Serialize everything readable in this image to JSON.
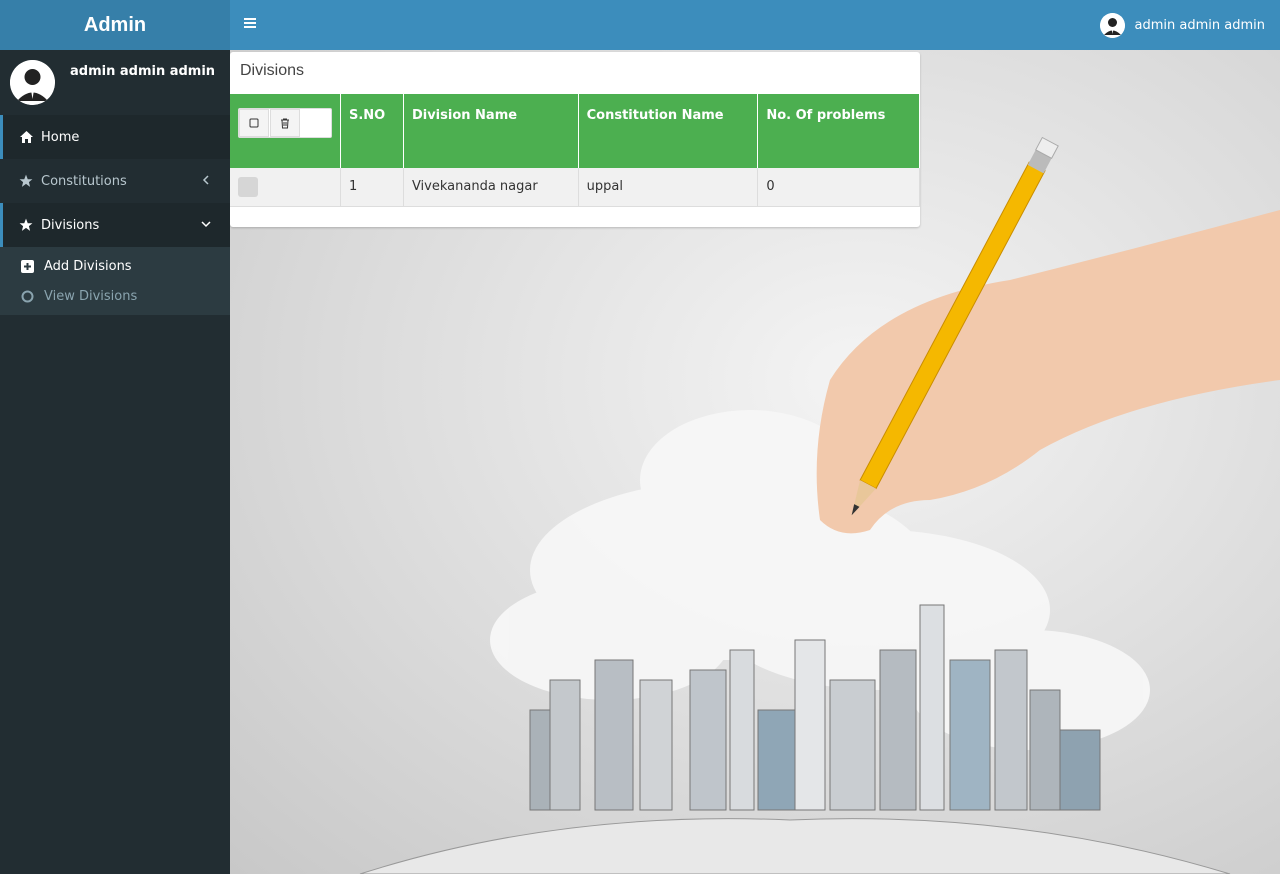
{
  "header": {
    "logo": "Admin",
    "user_name": "admin admin admin"
  },
  "sidebar": {
    "user_name": "admin admin admin",
    "items": [
      {
        "label": "Home",
        "icon": "home-icon"
      },
      {
        "label": "Constitutions",
        "icon": "star-icon"
      },
      {
        "label": "Divisions",
        "icon": "star-icon"
      }
    ],
    "submenu": [
      {
        "label": "Add Divisions",
        "icon": "plus-square-icon"
      },
      {
        "label": "View Divisions",
        "icon": "circle-icon"
      }
    ]
  },
  "page": {
    "title": "Divisions",
    "columns": [
      "S.NO",
      "Division Name",
      "Constitution Name",
      "No. Of problems"
    ],
    "rows": [
      [
        "1",
        "Vivekananda nagar",
        "uppal",
        "0"
      ]
    ]
  },
  "colors": {
    "header": "#3c8dbc",
    "logo_bg": "#367fa9",
    "sidebar": "#222d32",
    "table_header": "#4caf50"
  }
}
